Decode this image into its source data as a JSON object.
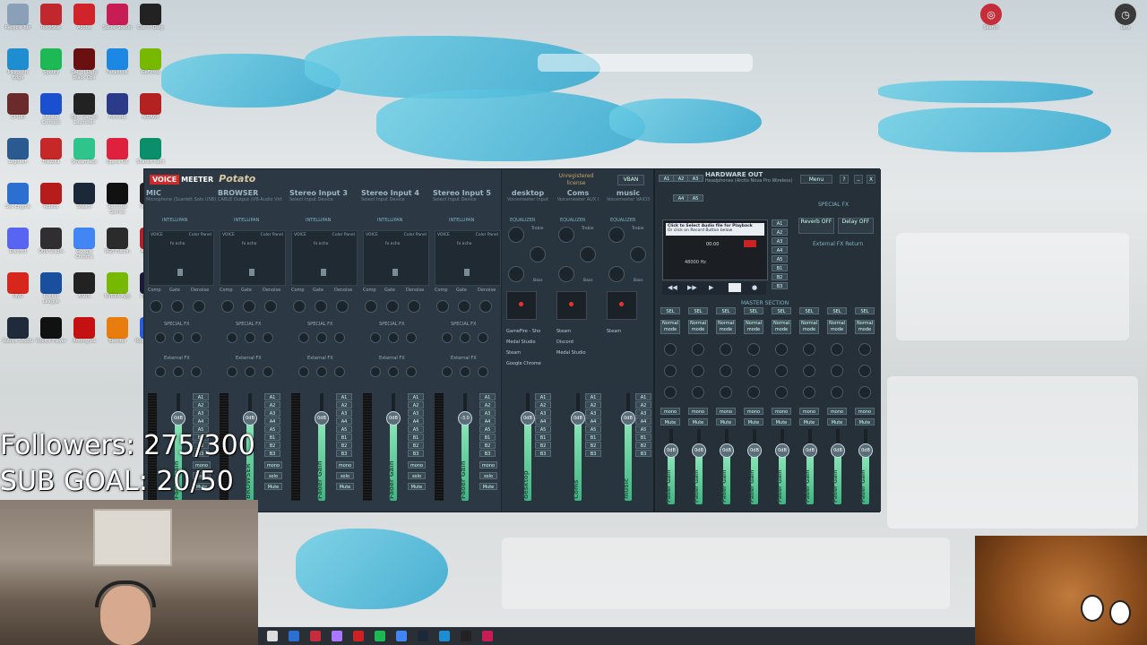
{
  "overlay": {
    "followers": "Followers: 275/300",
    "sub_goal": "SUB GOAL: 20/50"
  },
  "desktop_icons": [
    {
      "label": "Recycle Bin",
      "color": "#8aa0b8"
    },
    {
      "label": "RockStar",
      "color": "#c0282d"
    },
    {
      "label": "Adobe",
      "color": "#d1232a"
    },
    {
      "label": "Social Studio",
      "color": "#c81c55"
    },
    {
      "label": "Call of Duty",
      "color": "#222"
    },
    {
      "label": "Microsoft Edge",
      "color": "#1f8ed1"
    },
    {
      "label": "Spotify",
      "color": "#1db954"
    },
    {
      "label": "Call of Duty Black Ops",
      "color": "#6a1010"
    },
    {
      "label": "Facebook",
      "color": "#1d87e4"
    },
    {
      "label": "GeForce",
      "color": "#76b900"
    },
    {
      "label": "CPUID",
      "color": "#6b2b2b"
    },
    {
      "label": "Ubisoft Connect",
      "color": "#1a4fd0"
    },
    {
      "label": "Epic Games Launcher",
      "color": "#222"
    },
    {
      "label": "Fortnite",
      "color": "#2b3b8a"
    },
    {
      "label": "AIDA64",
      "color": "#b32121"
    },
    {
      "label": "Logitech",
      "color": "#2a5a90"
    },
    {
      "label": "FileZilla",
      "color": "#c62828"
    },
    {
      "label": "Streamlabs",
      "color": "#2ec48b"
    },
    {
      "label": "Opera GX",
      "color": "#e0213e"
    },
    {
      "label": "Shared Paint",
      "color": "#0a8f6a"
    },
    {
      "label": "Sec Engine",
      "color": "#2b6fd1"
    },
    {
      "label": "Roblox",
      "color": "#b71c1c"
    },
    {
      "label": "Steam",
      "color": "#1b2838"
    },
    {
      "label": "Rockstar Games",
      "color": "#111"
    },
    {
      "label": "VoiceMod",
      "color": "#222"
    },
    {
      "label": "Discord",
      "color": "#5865f2"
    },
    {
      "label": "OBS Studio",
      "color": "#302e31"
    },
    {
      "label": "Google Chrome",
      "color": "#4285f4"
    },
    {
      "label": "RGB Fusion",
      "color": "#2b2b2b"
    },
    {
      "label": "Armoury Crate",
      "color": "#b21f2d"
    },
    {
      "label": "UNO",
      "color": "#d7261c"
    },
    {
      "label": "Rocket League",
      "color": "#1a4fa0"
    },
    {
      "label": "ASUS",
      "color": "#222"
    },
    {
      "label": "NVIDIA App",
      "color": "#76b900"
    },
    {
      "label": "Premiere",
      "color": "#1a1a3a"
    },
    {
      "label": "Roblox Studio",
      "color": "#1f2a3a"
    },
    {
      "label": "Roblox Player",
      "color": "#111"
    },
    {
      "label": "Among Us",
      "color": "#c51111"
    },
    {
      "label": "Blender",
      "color": "#e87d0d"
    },
    {
      "label": "Roblox Player 2",
      "color": "#2b5bd8"
    }
  ],
  "right_icons": [
    {
      "label": "Search",
      "color": "#c62d3a"
    },
    {
      "label": "Lets",
      "color": "#3a3a3a"
    }
  ],
  "voicemeeter": {
    "brand": "VOICE",
    "brand2": "MEETER",
    "edition": "Potato",
    "license": "Unregistered license",
    "vban": "VBAN",
    "hardware_out": "HARDWARE OUT",
    "hw_sub": "Headphones (Arctis Nova Pro Wireless)",
    "menu": "Menu",
    "help": "?",
    "min": "_",
    "close": "X",
    "a_buttons": [
      "A1",
      "A2",
      "A3",
      "A4",
      "A5"
    ],
    "strips": [
      {
        "name": "MIC",
        "sub": "Microphone (Scarlett Solo USB)"
      },
      {
        "name": "BROWSER",
        "sub": "CABLE Output (VB-Audio Virt"
      },
      {
        "name": "Stereo Input 3",
        "sub": "Select Input Device"
      },
      {
        "name": "Stereo Input 4",
        "sub": "Select Input Device"
      },
      {
        "name": "Stereo Input 5",
        "sub": "Select Input Device"
      }
    ],
    "virtual_strips": [
      {
        "name": "desktop",
        "sub": "Voicemeeter Input"
      },
      {
        "name": "Coms",
        "sub": "Voicemeeter AUX I"
      },
      {
        "name": "music",
        "sub": "Voicemeeter VAIO3"
      }
    ],
    "intellipan": "INTELLIPAN",
    "color_panel": "Color Panel",
    "voice": "VOICE",
    "fx_echo": "fx echo",
    "knob_labels": [
      "Comp",
      "Gate",
      "Denoise"
    ],
    "special_fx": "SPECIAL FX",
    "reverb": "Reverb",
    "delay": "Delay",
    "external_fx": "External FX",
    "fader_gain": "Fader Gain",
    "fader_values": [
      "0dB",
      "0dB",
      "0dB",
      "0dB",
      "-3.0"
    ],
    "virtual_fader_values": [
      "0dB",
      "0dB",
      "0dB"
    ],
    "route_buttons": [
      "A1",
      "A2",
      "A3",
      "A4",
      "A5",
      "B1",
      "B2",
      "B3"
    ],
    "mono": "mono",
    "solo": "solo",
    "mute": "Mute",
    "mc": "M.C",
    "k": "K",
    "equalizer": "EQUALIZER",
    "treble": "Treble",
    "bass": "Bass",
    "apps_left": [
      "GameFire - Sho",
      "Medal Studio",
      "Steam",
      "Google Chrome"
    ],
    "apps_mid": [
      "Steam",
      "Discord",
      "Medal Studio"
    ],
    "apps_right": [
      "Steam"
    ],
    "recorder_text1": "Click to Select Audio file for Playback",
    "recorder_text2": "Or click on Record Button below",
    "time": "00:00",
    "freq": "48000 Hz",
    "master_section": "MASTER SECTION",
    "sel": "SEL",
    "normal_mode": "Normal mode",
    "bus_fader_values": [
      "0dB",
      "0dB",
      "0dB",
      "0dB",
      "0dB",
      "0dB",
      "0dB",
      "0dB"
    ],
    "special_fx_right": "SPECIAL FX",
    "reverb_off": "Reverb OFF",
    "delay_off": "Delay OFF",
    "external_fx_return": "External FX Return",
    "bus_a_labels": [
      "A1",
      "A2",
      "A3",
      "A4",
      "A5",
      "B1",
      "B2",
      "B3"
    ]
  }
}
